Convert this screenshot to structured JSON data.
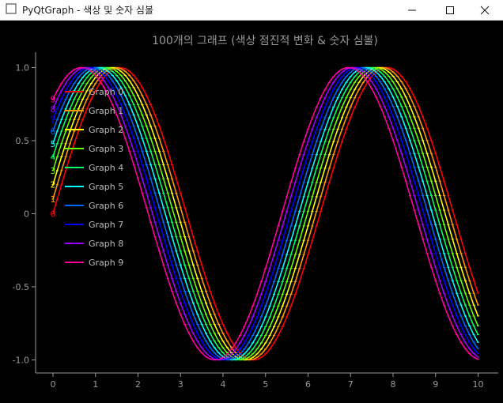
{
  "window": {
    "title": "PyQtGraph - 색상 및 숫자 심볼",
    "buttons": {
      "minimize": "minimize-icon",
      "maximize": "maximize-icon",
      "close": "close-icon"
    }
  },
  "chart_data": {
    "type": "line",
    "title": "100개의 그래프 (색상 점진적 변화 & 숫자 심볼)",
    "xlabel": "",
    "ylabel": "",
    "xlim": [
      -0.4,
      10.5
    ],
    "ylim": [
      -1.1,
      1.1
    ],
    "xticks": [
      "0",
      "1",
      "2",
      "3",
      "4",
      "5",
      "6",
      "7",
      "8",
      "9",
      "10"
    ],
    "yticks": [
      "-1.0",
      "-0.5",
      "0",
      "0.5",
      "1.0"
    ],
    "grid": false,
    "legend_position": "top-left",
    "function": "y = sin(x + i*0.1)",
    "series": [
      {
        "name": "Graph 0",
        "color": "#ff0000",
        "symbol": "0",
        "phase": 0.0
      },
      {
        "name": "Graph 1",
        "color": "#ff9900",
        "symbol": "1",
        "phase": 0.1
      },
      {
        "name": "Graph 2",
        "color": "#ffff00",
        "symbol": "2",
        "phase": 0.2
      },
      {
        "name": "Graph 3",
        "color": "#66ff00",
        "symbol": "3",
        "phase": 0.3
      },
      {
        "name": "Graph 4",
        "color": "#00ff66",
        "symbol": "4",
        "phase": 0.4
      },
      {
        "name": "Graph 5",
        "color": "#00ffff",
        "symbol": "5",
        "phase": 0.5
      },
      {
        "name": "Graph 6",
        "color": "#0066ff",
        "symbol": "6",
        "phase": 0.6
      },
      {
        "name": "Graph 7",
        "color": "#0000ff",
        "symbol": "7",
        "phase": 0.7
      },
      {
        "name": "Graph 8",
        "color": "#9900ff",
        "symbol": "8",
        "phase": 0.8
      },
      {
        "name": "Graph 9",
        "color": "#ff0099",
        "symbol": "9",
        "phase": 0.9
      }
    ]
  }
}
